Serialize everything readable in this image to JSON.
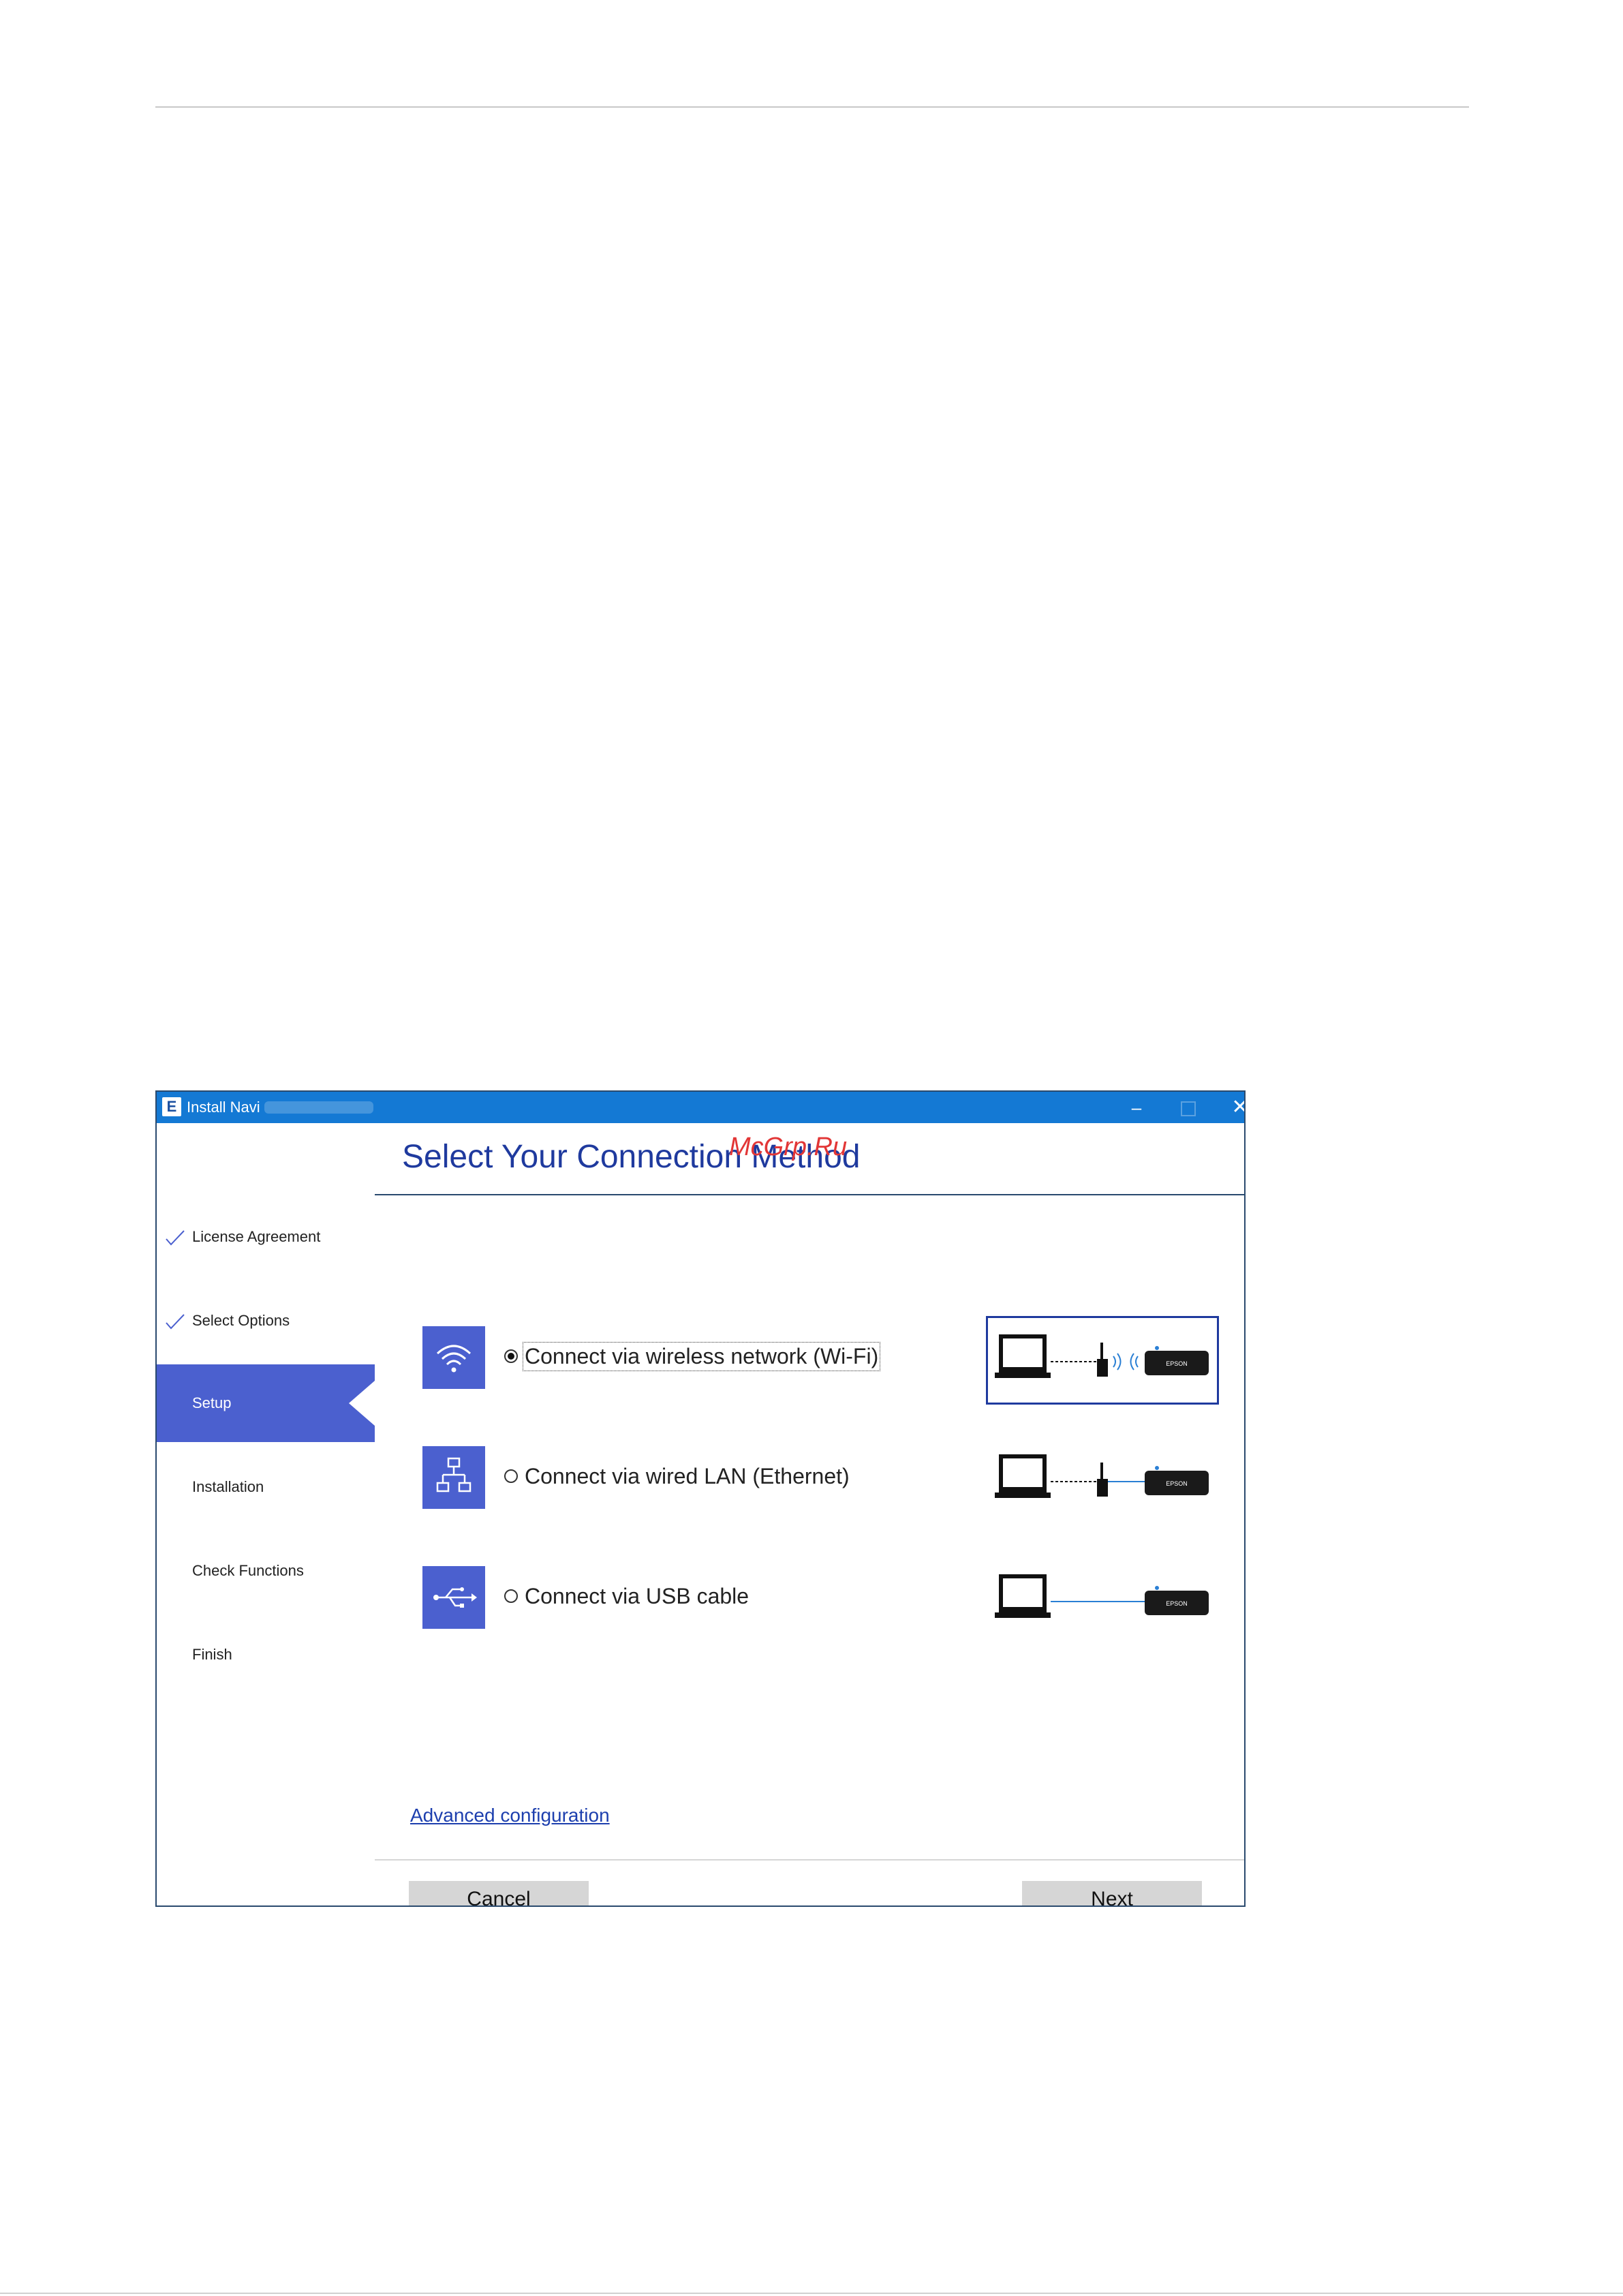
{
  "window": {
    "title": "Install Navi",
    "icon_letter": "E",
    "controls": {
      "minimize": "–",
      "maximize": "□",
      "close": "✕"
    }
  },
  "sidebar": {
    "steps": [
      {
        "label": "License Agreement",
        "state": "done"
      },
      {
        "label": "Select Options",
        "state": "done"
      },
      {
        "label": "Setup",
        "state": "active"
      },
      {
        "label": "Installation",
        "state": "pending"
      },
      {
        "label": "Check Functions",
        "state": "pending"
      },
      {
        "label": "Finish",
        "state": "pending"
      }
    ]
  },
  "main": {
    "title": "Select Your Connection Method",
    "watermark": "McGrp.Ru",
    "options": [
      {
        "label": "Connect via wireless network (Wi-Fi)",
        "icon": "wifi-icon",
        "selected": true
      },
      {
        "label": "Connect via wired LAN (Ethernet)",
        "icon": "network-icon",
        "selected": false
      },
      {
        "label": "Connect via USB cable",
        "icon": "usb-icon",
        "selected": false
      }
    ],
    "device_label": "EPSON",
    "advanced_link": "Advanced configuration"
  },
  "footer": {
    "cancel_label": "Cancel",
    "next_label": "Next"
  },
  "colors": {
    "titlebar": "#1479d4",
    "accent": "#4b60cf",
    "heading": "#1f3a9e",
    "link": "#1d3fae",
    "button": "#d6d6d6"
  }
}
